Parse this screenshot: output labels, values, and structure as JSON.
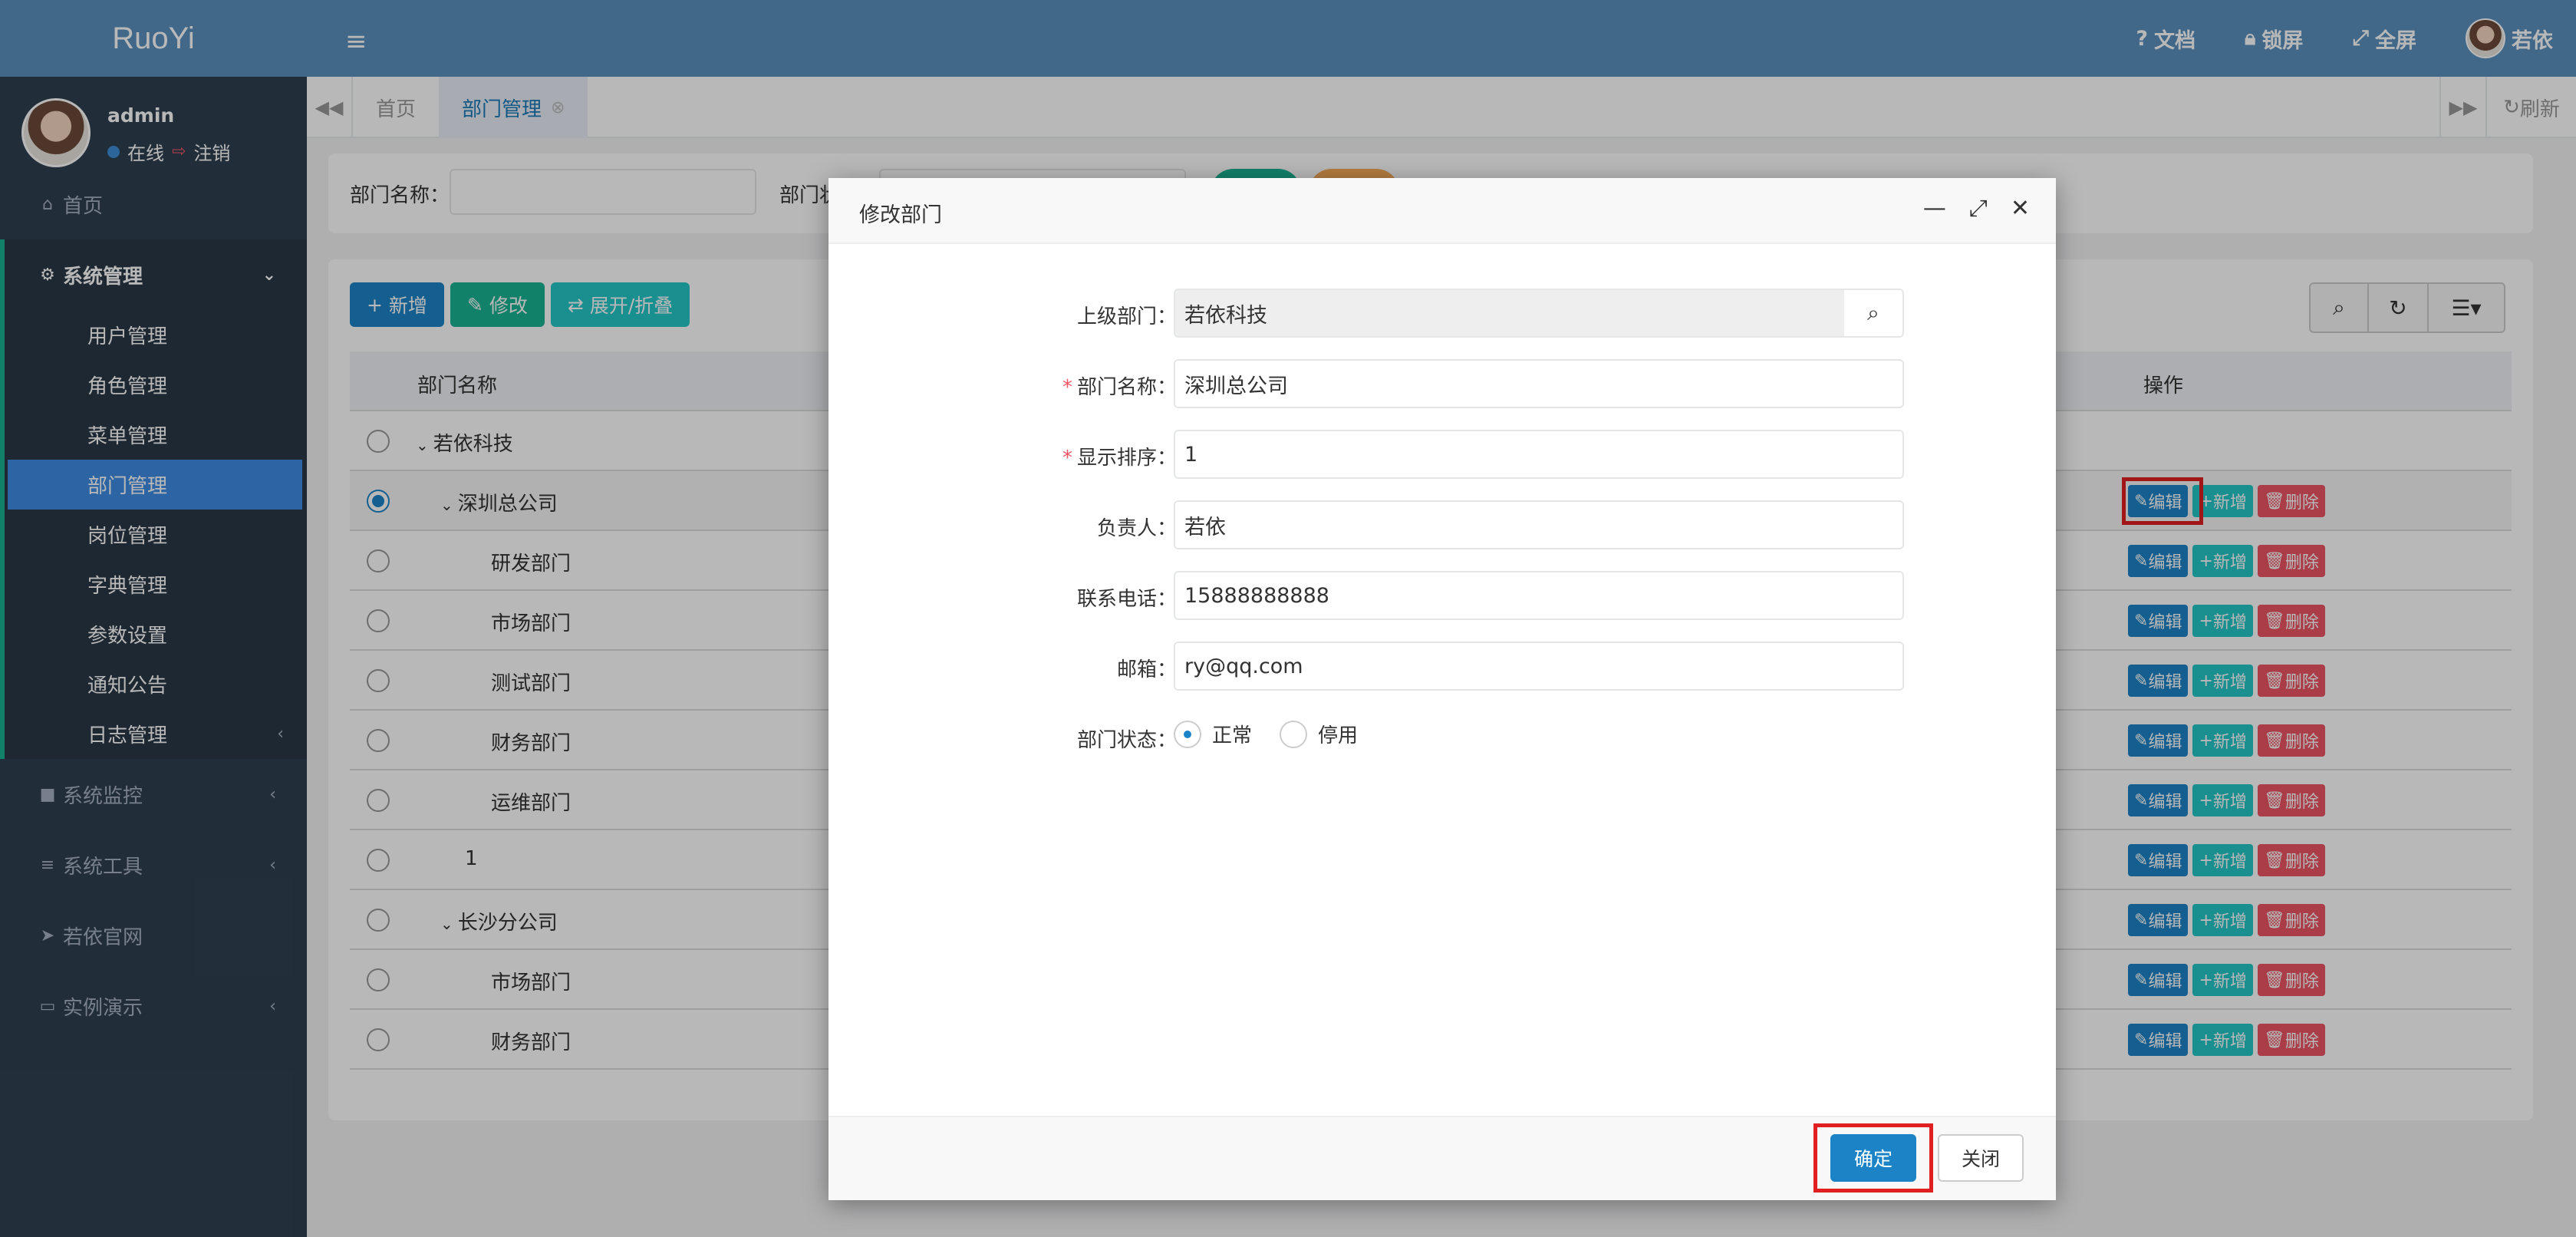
{
  "app": {
    "logo": "RuoYi"
  },
  "user": {
    "name": "admin",
    "status": "在线",
    "logout": "注销"
  },
  "sidebar": {
    "home": "首页",
    "system": "系统管理",
    "sub": [
      "用户管理",
      "角色管理",
      "菜单管理",
      "部门管理",
      "岗位管理",
      "字典管理",
      "参数设置",
      "通知公告",
      "日志管理"
    ],
    "monitor": "系统监控",
    "tools": "系统工具",
    "site": "若依官网",
    "demo": "实例演示"
  },
  "topbar": {
    "docs": "文档",
    "lock": "锁屏",
    "fullscreen": "全屏",
    "user": "若依"
  },
  "tabs": {
    "home": "首页",
    "active": "部门管理",
    "refresh": "刷新"
  },
  "search": {
    "dept_name_label": "部门名称：",
    "status_label": "部门状"
  },
  "toolbar": {
    "add": "新增",
    "edit": "修改",
    "expand": "展开/折叠"
  },
  "table": {
    "headers": {
      "name": "部门名称",
      "ops": "操作"
    },
    "rows": [
      {
        "name": "若依科技"
      },
      {
        "name": "深圳总公司"
      },
      {
        "name": "研发部门"
      },
      {
        "name": "市场部门"
      },
      {
        "name": "测试部门"
      },
      {
        "name": "财务部门"
      },
      {
        "name": "运维部门"
      },
      {
        "name": "1"
      },
      {
        "name": "长沙分公司"
      },
      {
        "name": "市场部门"
      },
      {
        "name": "财务部门"
      }
    ],
    "actions": {
      "edit": "编辑",
      "add": "新增",
      "del": "删除"
    }
  },
  "modal": {
    "title": "修改部门",
    "parent_label": "上级部门：",
    "parent_value": "若依科技",
    "name_label": "部门名称：",
    "name_value": "深圳总公司",
    "order_label": "显示排序：",
    "order_value": "1",
    "leader_label": "负责人：",
    "leader_value": "若依",
    "phone_label": "联系电话：",
    "phone_value": "15888888888",
    "email_label": "邮箱：",
    "email_value": "ry@qq.com",
    "status_label": "部门状态：",
    "status_normal": "正常",
    "status_disabled": "停用",
    "ok": "确定",
    "close": "关闭"
  },
  "colors": {
    "accent": "#1c84c6",
    "topbar": "#5a8fbe",
    "sidebar": "#2f4050",
    "highlight": "#e02020"
  }
}
